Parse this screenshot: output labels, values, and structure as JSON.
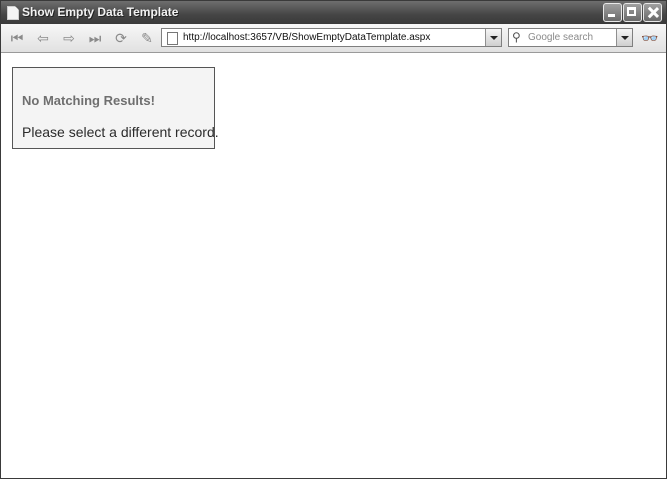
{
  "window": {
    "title": "Show Empty Data Template"
  },
  "toolbar": {
    "address": "http://localhost:3657/VB/ShowEmptyDataTemplate.aspx",
    "search_placeholder": "Google search"
  },
  "content": {
    "empty_title": "No Matching Results!",
    "empty_message": "Please select a different record."
  }
}
